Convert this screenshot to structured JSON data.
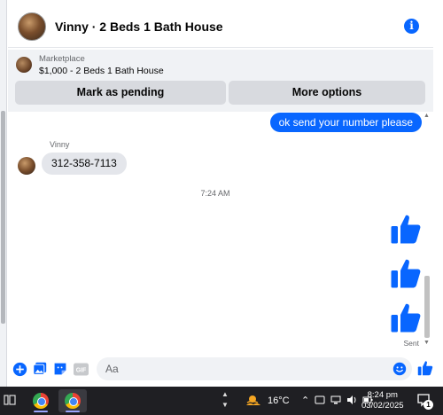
{
  "header": {
    "title": "Vinny · 2 Beds 1 Bath House",
    "info_glyph": "i"
  },
  "marketplace": {
    "label": "Marketplace",
    "item": "$1,000 - 2 Beds 1 Bath House",
    "pending_button": "Mark as pending",
    "more_button": "More options"
  },
  "messages": {
    "outgoing_text": "ok send your number please",
    "sender_name": "Vinny",
    "incoming_text": "312-358-7113",
    "timestamp": "7:24 AM",
    "status": "Sent",
    "likes_count": 3
  },
  "composer": {
    "placeholder": "Aa",
    "icons": [
      "add-icon",
      "photo-icon",
      "sticker-icon",
      "gif-icon",
      "emoji-icon",
      "like-icon"
    ],
    "gif_label": "GIF"
  },
  "taskbar": {
    "temperature": "16°C",
    "time": "8:24 pm",
    "date": "03/02/2025",
    "notification_count": "1",
    "tray_up_arrow": "⌃"
  },
  "colors": {
    "accent": "#0866ff",
    "bubble_in": "#e4e6eb",
    "panel": "#f0f2f5",
    "taskbar": "#1f1f23"
  }
}
